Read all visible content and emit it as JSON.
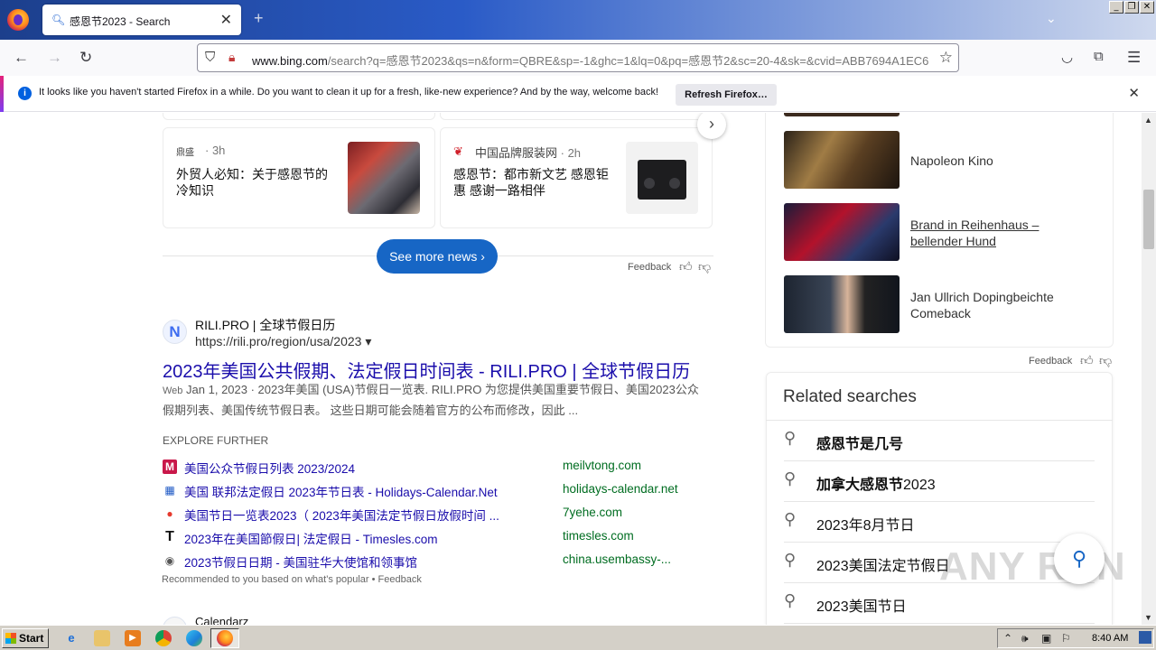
{
  "browser": {
    "tab_title": "感恩节2023 - Search",
    "url_domain": "www.bing.com",
    "url_rest": "/search?q=感恩节2023&qs=n&form=QBRE&sp=-1&ghc=1&lq=0&pq=感恩节2&sc=20-4&sk=&cvid=ABB7694A1EC6",
    "notification": {
      "message": "It looks like you haven't started Firefox in a while. Do you want to clean it up for a fresh, like-new experience? And by the way, welcome back!",
      "button": "Refresh Firefox…"
    }
  },
  "news": {
    "cards": [
      {
        "source_logo": "鼎盛",
        "source": "",
        "time": "· 3h",
        "headline": "外贸人必知：关于感恩节的冷知识"
      },
      {
        "source_logo": "❦",
        "source": "中国品牌服装网",
        "time": " · 2h",
        "headline": "感恩节：都市新文艺 感恩钜惠 感谢一路相伴"
      }
    ],
    "see_more": "See more news",
    "feedback": "Feedback"
  },
  "result": {
    "favicon": "N",
    "site": "RILI.PRO | 全球节假日历",
    "url": "https://rili.pro/region/usa/2023 ▾",
    "title": "2023年美国公共假期、法定假日时间表 - RILI.PRO | 全球节假日历",
    "snippet_tag": "Web",
    "snippet_date": "Jan 1, 2023",
    "snippet": " · 2023年美国 (USA)节假日一览表. RILI.PRO 为您提供美国重要节假日、美国2023公众假期列表、美国传统节假日表。 这些日期可能会随着官方的公布而修改，因此 ..."
  },
  "explore": {
    "heading": "EXPLORE FURTHER",
    "items": [
      {
        "icon": "M",
        "title": "美国公众节假日列表 2023/2024",
        "domain": "meilvtong.com"
      },
      {
        "icon": "▦",
        "title": "美国 联邦法定假日 2023年节日表 - Holidays-Calendar.Net",
        "domain": "holidays-calendar.net"
      },
      {
        "icon": "●",
        "title": "美国节日一览表2023（ 2023年美国法定节假日放假时间 ...",
        "domain": "7yehe.com"
      },
      {
        "icon": "T",
        "title": "2023年在美国節假日| 法定假日 - Timesles.com",
        "domain": "timesles.com"
      },
      {
        "icon": "◉",
        "title": "2023节假日日期 - 美国驻华大使馆和领事馆",
        "domain": "china.usembassy-..."
      }
    ],
    "recommended": "Recommended to you based on what's popular • Feedback",
    "next_site": "Calendarz"
  },
  "videos": [
    {
      "title": "Napoleon Kino",
      "link": false
    },
    {
      "title": "Brand in Reihenhaus – bellender Hund",
      "link": true
    },
    {
      "title": "Jan Ullrich Dopingbeichte Comeback",
      "link": false
    }
  ],
  "right_feedback": "Feedback",
  "related": {
    "heading": "Related searches",
    "items": [
      {
        "bold": "感恩节是几号",
        "plain": ""
      },
      {
        "bold": "加拿大感恩节",
        "plain": "2023"
      },
      {
        "bold": "",
        "plain": "2023年8月节日"
      },
      {
        "bold": "",
        "plain": "2023美国法定节假日"
      },
      {
        "bold": "",
        "plain": "2023美国节日"
      }
    ]
  },
  "watermark": "ANY RUN",
  "taskbar": {
    "start": "Start",
    "clock": "8:40 AM"
  },
  "colors": {
    "link": "#1a0dab",
    "url_green": "#006d21",
    "bing_blue": "#1766c5"
  }
}
